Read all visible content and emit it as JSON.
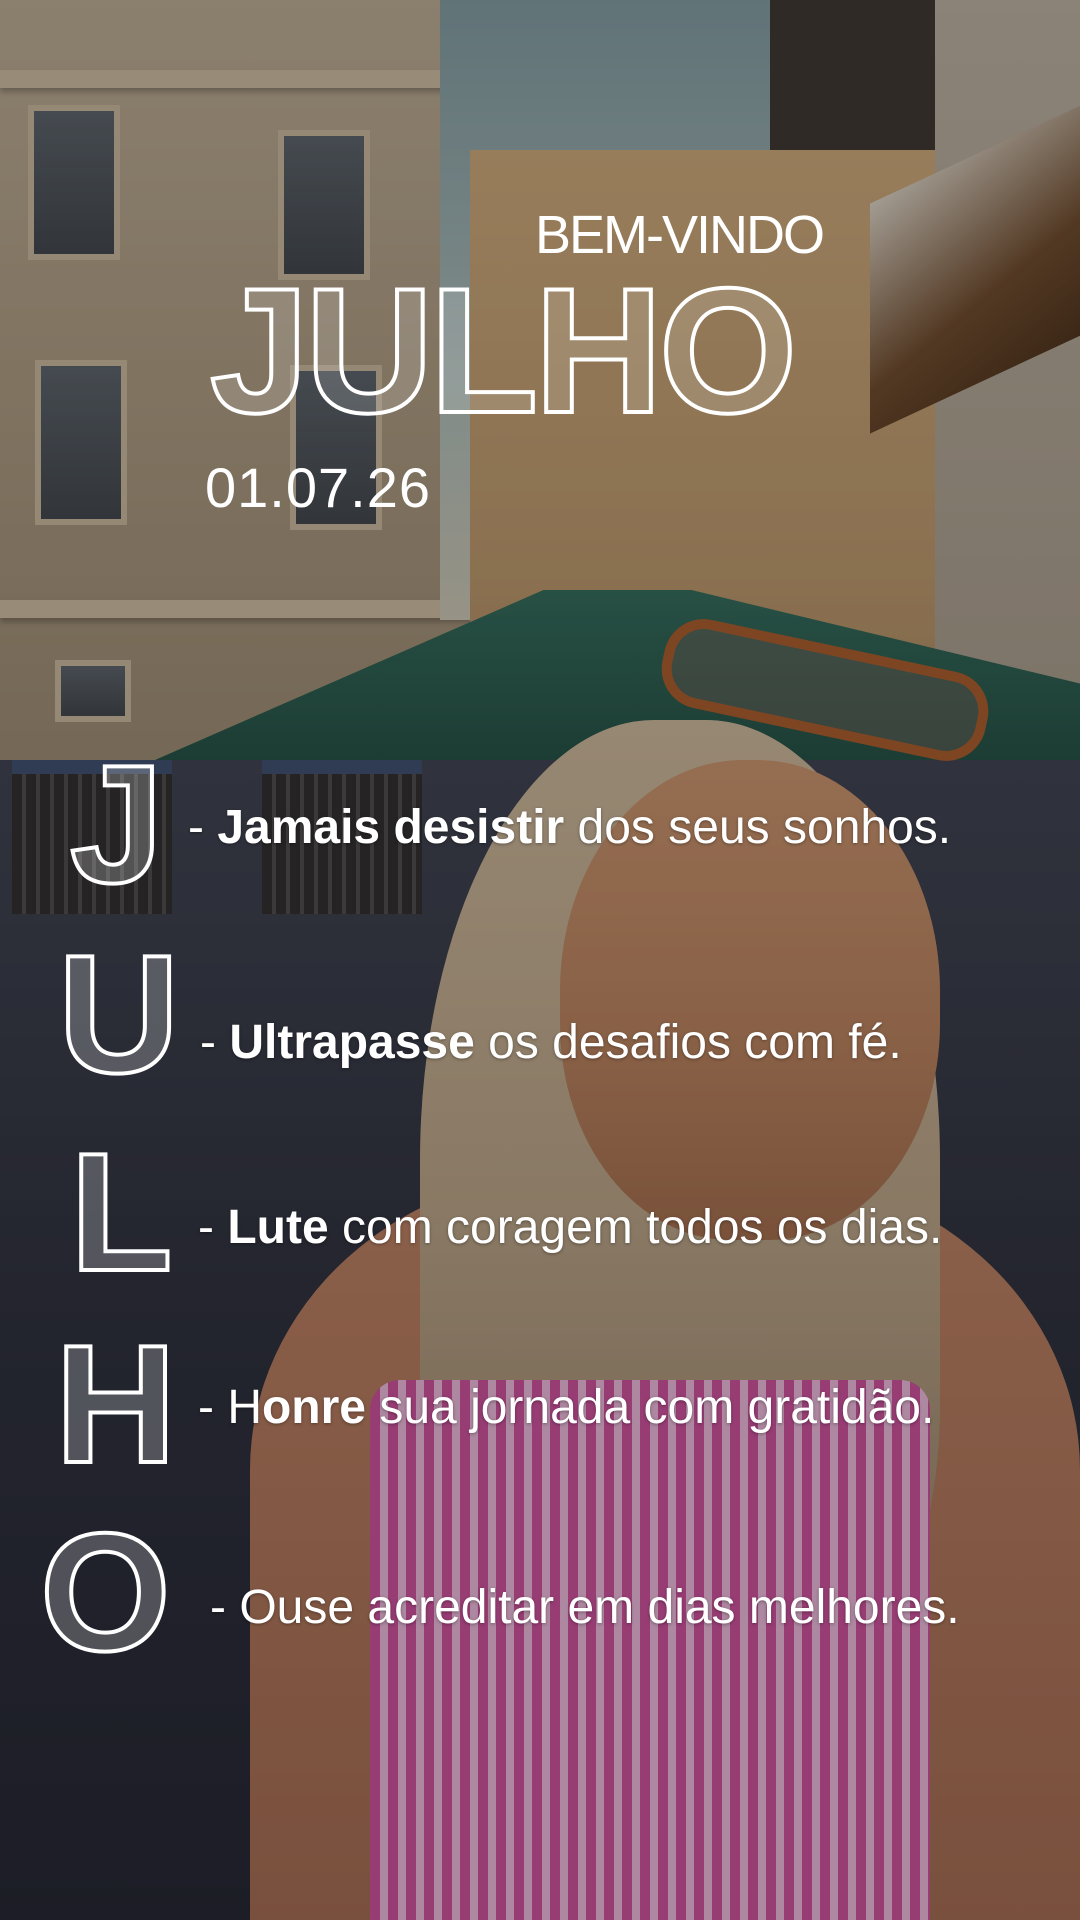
{
  "header": {
    "welcome": "BEM-VINDO",
    "month": "JULHO",
    "date": "01.07.26"
  },
  "acrostic": [
    {
      "letter": "J",
      "dash": "- ",
      "bold": "Jamais desistir",
      "rest": " dos seus sonhos."
    },
    {
      "letter": "U",
      "dash": "- ",
      "bold": "Ultrapasse",
      "rest": " os desafios com fé."
    },
    {
      "letter": "L",
      "dash": "- ",
      "bold": "Lute",
      "rest": " com coragem todos os dias."
    },
    {
      "letter": "H",
      "dash": "- H",
      "bold": "onre",
      "rest": " sua jornada com gratidão."
    },
    {
      "letter": "O",
      "dash": "- ",
      "bold": "",
      "rest": "Ouse acreditar em dias melhores."
    }
  ]
}
